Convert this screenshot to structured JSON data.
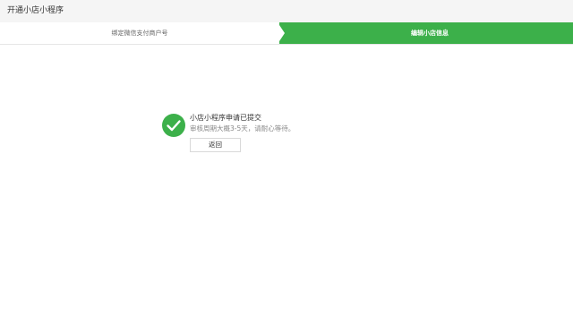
{
  "header": {
    "title": "开通小店小程序"
  },
  "steps": [
    {
      "label": "绑定微信支付商户号",
      "active": false
    },
    {
      "label": "编辑小店信息",
      "active": true
    }
  ],
  "result": {
    "icon": "check-circle-icon",
    "title": "小店小程序申请已提交",
    "description": "审核周期大概3-5天，请耐心等待。",
    "back_label": "返回"
  },
  "colors": {
    "accent": "#3cb04a",
    "header_bg": "#f5f5f5"
  }
}
